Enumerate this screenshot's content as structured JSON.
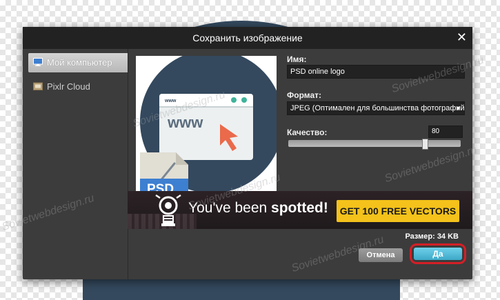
{
  "dialog": {
    "title": "Сохранить изображение",
    "close_glyph": "✕"
  },
  "sidebar": {
    "items": [
      {
        "label": "Мой компьютер",
        "icon": "monitor-icon",
        "active": true
      },
      {
        "label": "Pixlr Cloud",
        "icon": "cloud-storage-icon",
        "active": false
      }
    ]
  },
  "preview": {
    "browser_text": "www",
    "file_badge": "PSD"
  },
  "form": {
    "name_label": "Имя:",
    "name_value": "PSD online logo",
    "format_label": "Формат:",
    "format_value": "JPEG (Оптимален для большинства фотографий",
    "quality_label": "Качество:",
    "quality_value": "80",
    "quality_fraction": 0.8
  },
  "ad": {
    "text_normal": "You've been ",
    "text_bold": "spotted!",
    "cta": "GET 100 FREE VECTORS"
  },
  "size_text": "Размер: 34 KB",
  "buttons": {
    "cancel": "Отмена",
    "ok": "Да"
  },
  "watermark": "Sovietwebdesign.ru",
  "colors": {
    "dialog_bg": "#3c3c3c",
    "titlebar_bg": "#222222",
    "ok_button": "#4db8d8",
    "highlight_ring": "#d51f26",
    "ad_cta": "#f4c21a",
    "preview_circle": "#34495e",
    "cursor_arrow": "#ea6a4b"
  }
}
